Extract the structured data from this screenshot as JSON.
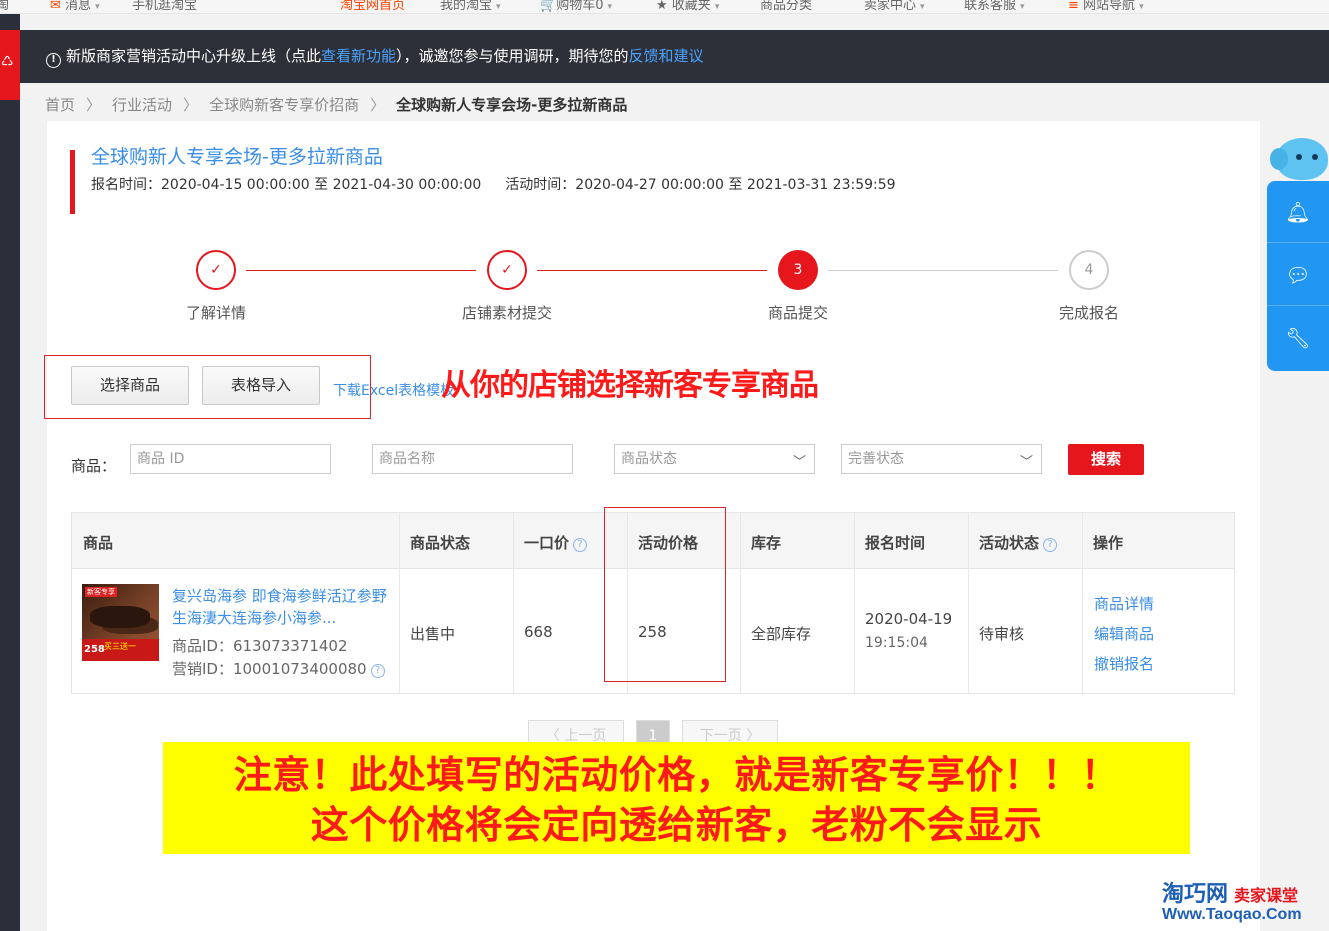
{
  "topnav": [
    {
      "label": "淘",
      "red": false,
      "arrow": false
    },
    {
      "label": "消息",
      "red": false,
      "arrow": true
    },
    {
      "label": "手机逛淘宝",
      "red": false,
      "arrow": false
    },
    {
      "label": "淘宝网首页",
      "red": true,
      "arrow": false
    },
    {
      "label": "我的淘宝",
      "red": false,
      "arrow": true
    },
    {
      "label": "购物车0",
      "red": true,
      "arrow": true
    },
    {
      "label": "收藏夹",
      "red": false,
      "arrow": true
    },
    {
      "label": "商品分类",
      "red": false,
      "arrow": false
    },
    {
      "label": "卖家中心",
      "red": false,
      "arrow": true
    },
    {
      "label": "联系客服",
      "red": false,
      "arrow": true
    },
    {
      "label": "网站导航",
      "red": false,
      "arrow": true
    }
  ],
  "notice": {
    "text_before": "新版商家营销活动中心升级上线（点此",
    "link1": "查看新功能",
    "text_mid": "），诚邀您参与使用调研，期待您的",
    "link2": "反馈和建议"
  },
  "breadcrumb": [
    "首页",
    "行业活动",
    "全球购新客专享价招商",
    "全球购新人专享会场-更多拉新商品"
  ],
  "activity": {
    "title": "全球购新人专享会场-更多拉新商品",
    "signup_time": "报名时间：2020-04-15 00:00:00 至 2021-04-30 00:00:00",
    "activity_time": "活动时间：2020-04-27 00:00:00 至 2021-03-31 23:59:59"
  },
  "steps": [
    {
      "num": "✓",
      "label": "了解详情",
      "state": "done"
    },
    {
      "num": "✓",
      "label": "店铺素材提交",
      "state": "done"
    },
    {
      "num": "3",
      "label": "商品提交",
      "state": "active"
    },
    {
      "num": "4",
      "label": "完成报名",
      "state": "todo"
    }
  ],
  "actions": {
    "select_goods": "选择商品",
    "import_table": "表格导入",
    "download_template": "下载Excel表格模板"
  },
  "annotation_top": "从你的店铺选择新客专享商品",
  "search": {
    "label": "商品：",
    "id_placeholder": "商品 ID",
    "name_placeholder": "商品名称",
    "status_placeholder": "商品状态",
    "complete_placeholder": "完善状态",
    "button": "搜索"
  },
  "table": {
    "headers": [
      "商品",
      "商品状态",
      "一口价",
      "活动价格",
      "库存",
      "报名时间",
      "活动状态",
      "操作"
    ],
    "row": {
      "thumb_badge": "新客专享",
      "thumb_banner": "买三送一",
      "thumb_price": "258",
      "title": "复兴岛海参 即食海参鲜活辽参野生海淒大连海参小海参...",
      "goods_id": "商品ID：613073371402",
      "marketing_id": "营销ID：10001073400080",
      "status": "出售中",
      "price": "668",
      "activity_price": "258",
      "stock": "全部库存",
      "signup_date": "2020-04-19",
      "signup_clock": "19:15:04",
      "activity_status": "待审核",
      "ops": [
        "商品详情",
        "编辑商品",
        "撤销报名"
      ]
    }
  },
  "pager": {
    "prev": "〈 上一页",
    "page": "1",
    "next": "下一页 〉"
  },
  "warning": {
    "line1": "注意！此处填写的活动价格，就是新客专享价！！！",
    "line2": "这个价格将会定向透给新客，老粉不会显示"
  },
  "watermark": {
    "logo": "淘巧网",
    "sub": "卖家课堂",
    "url": "Www.Taoqao.Com"
  },
  "colors": {
    "accent": "#e5161c",
    "link": "#3a8ee6",
    "float_panel": "#2196f3",
    "warning_bg": "#ffff00"
  }
}
